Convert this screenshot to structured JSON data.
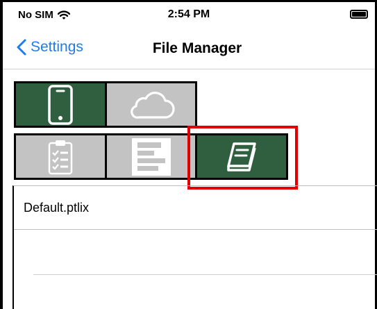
{
  "status_bar": {
    "carrier": "No SIM",
    "time": "2:54 PM"
  },
  "nav": {
    "back_label": "Settings",
    "title": "File Manager"
  },
  "sources": [
    {
      "name": "device",
      "icon": "phone-icon",
      "selected": true
    },
    {
      "name": "cloud",
      "icon": "cloud-icon",
      "selected": false
    }
  ],
  "file_types": [
    {
      "name": "checklist",
      "icon": "clipboard-checklist-icon",
      "selected": false
    },
    {
      "name": "report",
      "icon": "bar-report-icon",
      "selected": false
    },
    {
      "name": "library",
      "icon": "book-icon",
      "selected": true
    }
  ],
  "files": [
    "Default.ptlix"
  ],
  "colors": {
    "selected_cell": "#2f5f3f",
    "unselected_cell": "#c3c3c3",
    "accent": "#1e7cf2",
    "highlight": "#e00000"
  }
}
